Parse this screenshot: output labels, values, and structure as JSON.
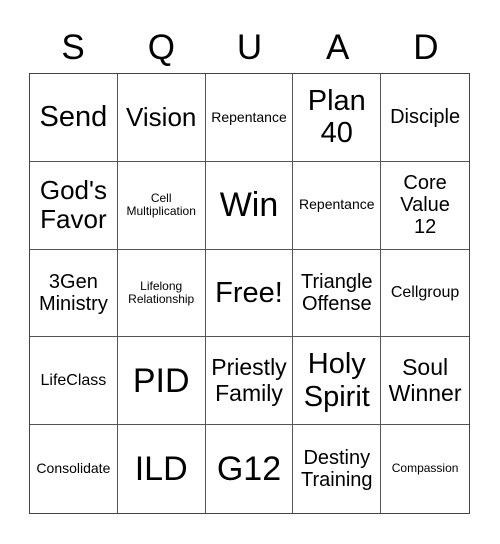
{
  "header": {
    "letters": [
      "S",
      "Q",
      "U",
      "A",
      "D"
    ]
  },
  "board": {
    "rows": [
      [
        "Send",
        "Vision",
        "Repentance",
        "Plan\n40",
        "Disciple"
      ],
      [
        "God's\nFavor",
        "Cell\nMultiplication",
        "Win",
        "Repentance",
        "Core\nValue\n12"
      ],
      [
        "3Gen\nMinistry",
        "Lifelong\nRelationship",
        "Free!",
        "Triangle\nOffense",
        "Cellgroup"
      ],
      [
        "LifeClass",
        "PID",
        "Priestly\nFamily",
        "Holy\nSpirit",
        "Soul\nWinner"
      ],
      [
        "Consolidate",
        "ILD",
        "G12",
        "Destiny\nTraining",
        "Compassion"
      ]
    ],
    "free_space": "Free!"
  }
}
